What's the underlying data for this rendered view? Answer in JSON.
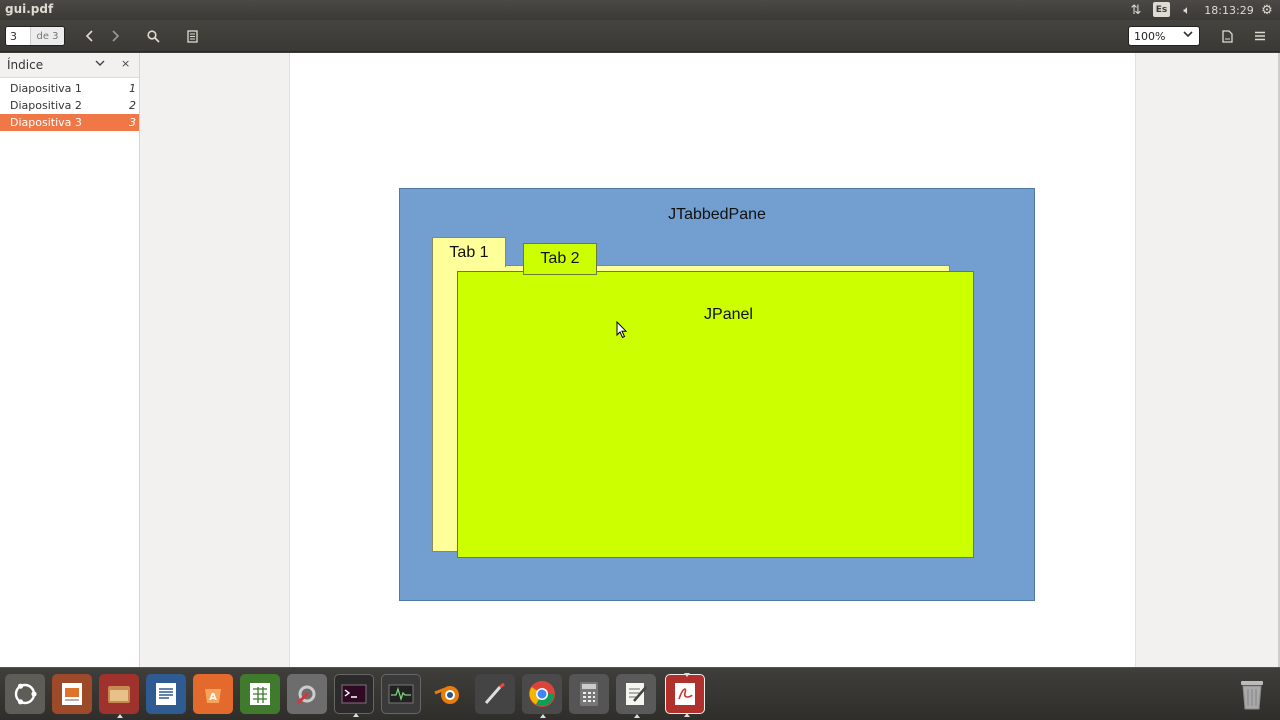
{
  "window": {
    "title": "gui.pdf"
  },
  "tray": {
    "network_icon": "transfer-arrows-icon",
    "keyboard_layout": "Es",
    "sound_icon": "speaker-icon",
    "clock": "18:13:29",
    "settings_icon": "gear-icon"
  },
  "toolbar": {
    "current_page": "3",
    "page_of": "de 3",
    "zoom": "100%",
    "icons": [
      "chevron-left-icon",
      "chevron-right-icon",
      "search-icon",
      "annotations-icon",
      "document-properties-icon",
      "hamburger-menu-icon"
    ]
  },
  "sidebar": {
    "title": "Índice",
    "items": [
      {
        "label": "Diapositiva 1",
        "page": "1",
        "selected": false
      },
      {
        "label": "Diapositiva 2",
        "page": "2",
        "selected": false
      },
      {
        "label": "Diapositiva 3",
        "page": "3",
        "selected": true
      }
    ]
  },
  "diagram": {
    "container_label": "JTabbedPane",
    "tab1_label": "Tab 1",
    "tab2_label": "Tab 2",
    "panel_label": "JPanel",
    "colors": {
      "container": "#729fcf",
      "tab1": "#ffff99",
      "tab2": "#ccff00",
      "panel": "#ccff00"
    }
  },
  "dock": {
    "apps": [
      "ubuntu-dash-icon",
      "impress-icon",
      "file-manager-icon",
      "writer-icon",
      "software-center-icon",
      "calc-icon",
      "system-settings-icon",
      "terminal-icon",
      "system-monitor-icon",
      "blender-icon",
      "drawing-tool-icon",
      "chrome-icon",
      "calculator-icon",
      "text-editor-icon",
      "pdf-viewer-icon",
      "trash-icon"
    ]
  },
  "accent_color": "#f07746"
}
